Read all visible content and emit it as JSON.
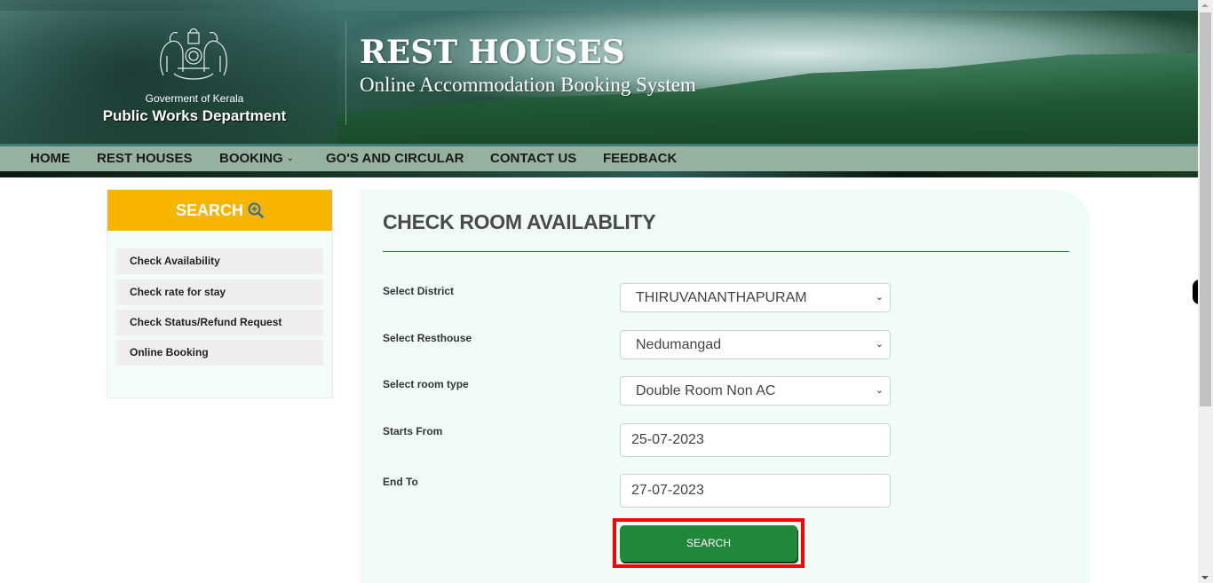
{
  "header": {
    "government": "Goverment of Kerala",
    "department": "Public Works Department",
    "site_title": "REST HOUSES",
    "site_subtitle": "Online Accommodation Booking System"
  },
  "nav": {
    "items": [
      {
        "label": "HOME"
      },
      {
        "label": "REST HOUSES"
      },
      {
        "label": "BOOKING",
        "has_dropdown": true
      },
      {
        "label": "GO'S AND CIRCULAR"
      },
      {
        "label": "CONTACT US"
      },
      {
        "label": "FEEDBACK"
      }
    ],
    "dropdown_caret": "⌄"
  },
  "sidebar": {
    "title": "SEARCH",
    "title_icon": "zoom-in-icon",
    "items": [
      {
        "label": "Check Availability"
      },
      {
        "label": "Check rate for stay"
      },
      {
        "label": "Check Status/Refund Request"
      },
      {
        "label": "Online Booking"
      }
    ]
  },
  "main": {
    "title": "CHECK ROOM AVAILABLITY",
    "fields": [
      {
        "label": "Select District",
        "type": "select",
        "value": "THIRUVANANTHAPURAM"
      },
      {
        "label": "Select Resthouse",
        "type": "select",
        "value": "Nedumangad"
      },
      {
        "label": "Select room type",
        "type": "select",
        "value": "Double Room Non AC"
      },
      {
        "label": "Starts From",
        "type": "date",
        "value": "25-07-2023"
      },
      {
        "label": "End To",
        "type": "date",
        "value": "27-07-2023"
      }
    ],
    "search_button": "SEARCH",
    "select_chevron": "⌄"
  },
  "colors": {
    "accent_yellow": "#f8b500",
    "nav_bg": "#97b1a1",
    "button_green": "#21873a",
    "highlight_red": "#ff0000",
    "rule_blue": "#1a6496",
    "panel_bg": "#f2fcf7"
  }
}
